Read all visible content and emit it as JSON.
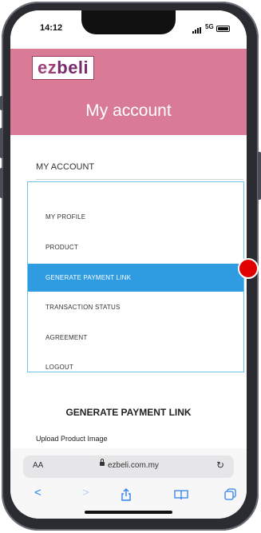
{
  "status_bar": {
    "time": "14:12",
    "network": "5G"
  },
  "header": {
    "logo_prefix": "ez",
    "logo_suffix": "beli",
    "title": "My account"
  },
  "section_label": "MY ACCOUNT",
  "menu": {
    "items": [
      {
        "label": "MY PROFILE"
      },
      {
        "label": "PRODUCT"
      },
      {
        "label": "GENERATE PAYMENT LINK",
        "active": true
      },
      {
        "label": "TRANSACTION STATUS"
      },
      {
        "label": "AGREEMENT"
      },
      {
        "label": "LOGOUT"
      }
    ]
  },
  "main": {
    "heading": "GENERATE PAYMENT LINK",
    "upload_label": "Upload Product Image"
  },
  "browser": {
    "text_size": "AA",
    "url": "ezbeli.com.my",
    "icons": [
      "back-icon",
      "forward-icon",
      "share-icon",
      "bookmarks-icon",
      "tabs-icon",
      "reload-icon",
      "lock-icon"
    ]
  },
  "colors": {
    "header_bg": "#d97b97",
    "active_item": "#2f9be0",
    "menu_border": "#6cc1e4",
    "marker": "#e00000"
  }
}
